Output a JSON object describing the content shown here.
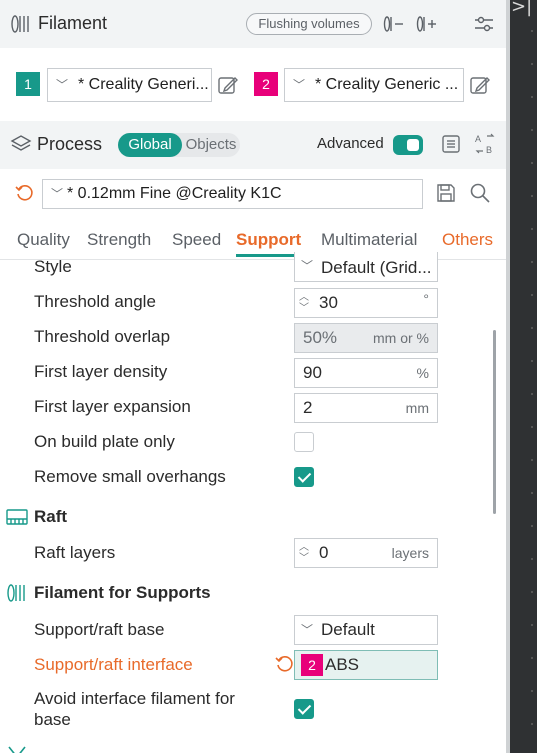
{
  "filament": {
    "title": "Filament",
    "flushing_label": "Flushing volumes",
    "slots": [
      {
        "number": "1",
        "preset": "* Creality Generi...",
        "color": "#17998a"
      },
      {
        "number": "2",
        "preset": "* Creality Generic ...",
        "color": "#e8007a"
      }
    ]
  },
  "process": {
    "title": "Process",
    "scope_on": "Global",
    "scope_off": "Objects",
    "advanced_label": "Advanced",
    "advanced_on": true,
    "preset": "* 0.12mm Fine @Creality K1C"
  },
  "tabs": [
    "Quality",
    "Strength",
    "Speed",
    "Support",
    "Multimaterial",
    "Others"
  ],
  "active_tab": "Support",
  "support": {
    "style": {
      "label": "Style",
      "value": "Default (Grid..."
    },
    "threshold_angle": {
      "label": "Threshold angle",
      "value": "30",
      "unit": "°"
    },
    "threshold_overlap": {
      "label": "Threshold overlap",
      "value": "50%",
      "unit": "mm or %"
    },
    "first_layer_density": {
      "label": "First layer density",
      "value": "90",
      "unit": "%"
    },
    "first_layer_expansion": {
      "label": "First layer expansion",
      "value": "2",
      "unit": "mm"
    },
    "on_build_plate_only": {
      "label": "On build plate only",
      "checked": false
    },
    "remove_small_overhangs": {
      "label": "Remove small overhangs",
      "checked": true
    }
  },
  "raft": {
    "title": "Raft",
    "raft_layers": {
      "label": "Raft layers",
      "value": "0",
      "unit": "layers"
    }
  },
  "filament_for_supports": {
    "title": "Filament for Supports",
    "base": {
      "label": "Support/raft base",
      "value": "Default"
    },
    "interface": {
      "label": "Support/raft interface",
      "badge": "2",
      "value": "ABS"
    },
    "avoid_interface": {
      "label_line1": "Avoid interface filament for",
      "label_line2": "base",
      "checked": true
    }
  },
  "colors": {
    "accent": "#17998a",
    "modified": "#e86a2a",
    "slot2": "#e8007a"
  },
  "icons": [
    "filament-icon",
    "settings-sliders-icon",
    "edit-icon",
    "process-layers-icon",
    "list-icon",
    "compare-icon",
    "reset-icon",
    "save-icon",
    "search-icon",
    "raft-icon",
    "filament-support-icon"
  ]
}
